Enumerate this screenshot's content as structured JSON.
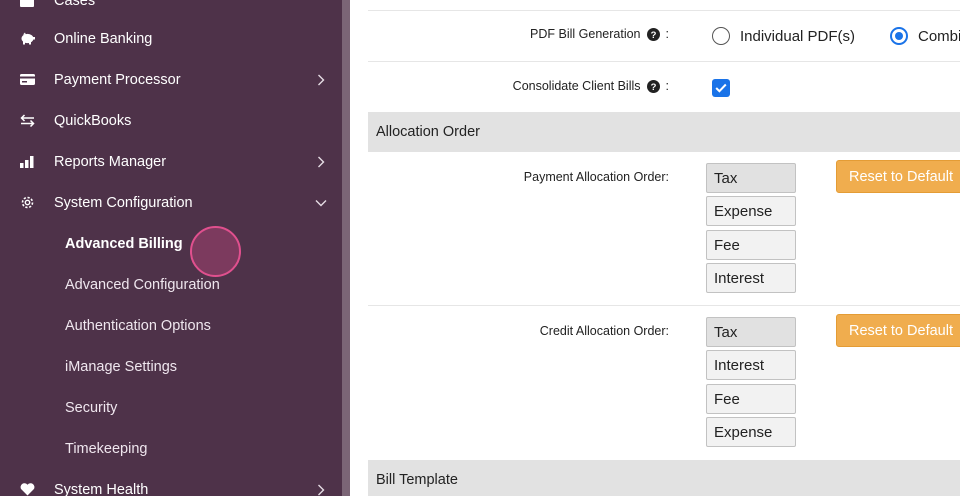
{
  "sidebar": {
    "top_partial": "Cases",
    "items": [
      {
        "label": "Online Banking",
        "icon": "piggy-bank-icon",
        "chevron": false
      },
      {
        "label": "Payment Processor",
        "icon": "credit-card-icon",
        "chevron": "right"
      },
      {
        "label": "QuickBooks",
        "icon": "exchange-arrows-icon",
        "chevron": false
      },
      {
        "label": "Reports Manager",
        "icon": "bar-chart-icon",
        "chevron": "right"
      },
      {
        "label": "System Configuration",
        "icon": "gear-icon",
        "chevron": "down"
      }
    ],
    "sub_items": [
      {
        "label": "Advanced Billing",
        "active": true
      },
      {
        "label": "Advanced Configuration",
        "active": false
      },
      {
        "label": "Authentication Options",
        "active": false
      },
      {
        "label": "iManage Settings",
        "active": false
      },
      {
        "label": "Security",
        "active": false
      },
      {
        "label": "Timekeeping",
        "active": false
      }
    ],
    "bottom_item": {
      "label": "System Health",
      "icon": "heart-icon",
      "chevron": "right"
    }
  },
  "main": {
    "pdf_generation": {
      "label": "PDF Bill Generation",
      "options": [
        {
          "label": "Individual PDF(s)",
          "checked": false
        },
        {
          "label": "Combi",
          "checked": true
        }
      ]
    },
    "consolidate": {
      "label": "Consolidate Client Bills",
      "checked": true
    },
    "allocation_section": {
      "title": "Allocation Order"
    },
    "payment_allocation": {
      "label": "Payment Allocation Order:",
      "items": [
        "Tax",
        "Expense",
        "Fee",
        "Interest"
      ],
      "reset_label": "Reset to Default"
    },
    "credit_allocation": {
      "label": "Credit Allocation Order:",
      "items": [
        "Tax",
        "Interest",
        "Fee",
        "Expense"
      ],
      "reset_label": "Reset to Default"
    },
    "bill_template_section": {
      "title": "Bill Template"
    }
  },
  "colors": {
    "sidebar_bg": "#4e3249",
    "section_bg": "#e2e2e2",
    "accent_blue": "#1a73e8",
    "reset_orange": "#f0ad4e"
  }
}
